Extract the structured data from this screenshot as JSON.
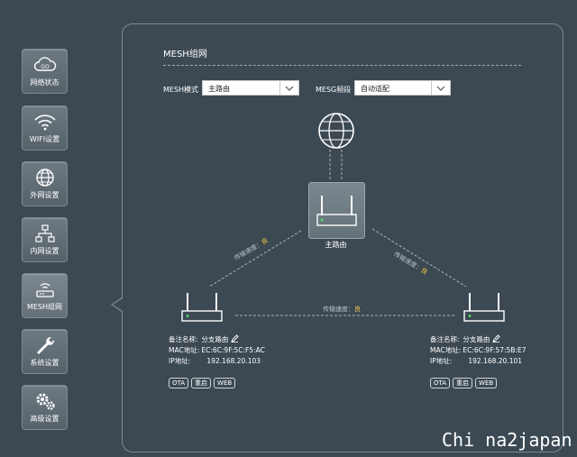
{
  "sidebar": {
    "items": [
      {
        "label": "网络状态",
        "icon": "cloud-icon"
      },
      {
        "label": "WIFI设置",
        "icon": "wifi-icon"
      },
      {
        "label": "外网设置",
        "icon": "globe-icon"
      },
      {
        "label": "内网设置",
        "icon": "network-icon"
      },
      {
        "label": "MESH组网",
        "icon": "router-icon"
      },
      {
        "label": "系统设置",
        "icon": "wrench-icon"
      },
      {
        "label": "高级设置",
        "icon": "gears-icon"
      }
    ],
    "active_index": 4
  },
  "panel": {
    "title": "MESH组网",
    "mesh_mode": {
      "label": "MESH模式",
      "value": "主路由"
    },
    "mesh_band": {
      "label": "MESG频段",
      "value": "自动适配"
    }
  },
  "topology": {
    "main_router_label": "主路由",
    "links": [
      {
        "text": "传输速度：",
        "quality": "良"
      },
      {
        "text": "传输速度：",
        "quality": "良"
      },
      {
        "text": "传输速度：",
        "quality": "良"
      }
    ],
    "nodes": [
      {
        "name_key": "备注名称:",
        "name_val": "分支路由",
        "mac_key": "MAC地址:",
        "mac_val": "EC:6C:9F:5C:F5:AC",
        "ip_key": "IP地址:",
        "ip_val": "192.168.20.103",
        "buttons": [
          "OTA",
          "重启",
          "WEB"
        ]
      },
      {
        "name_key": "备注名称:",
        "name_val": "分支路由",
        "mac_key": "MAC地址:",
        "mac_val": "EC:6C:9F:57:5B:E7",
        "ip_key": "IP地址:",
        "ip_val": "192.168.20.101",
        "buttons": [
          "OTA",
          "重启",
          "WEB"
        ]
      }
    ]
  },
  "watermark": "Chi na2japan",
  "colors": {
    "background": "#3c4953",
    "accent_good": "#f3c34a",
    "led": "#4cd964"
  }
}
